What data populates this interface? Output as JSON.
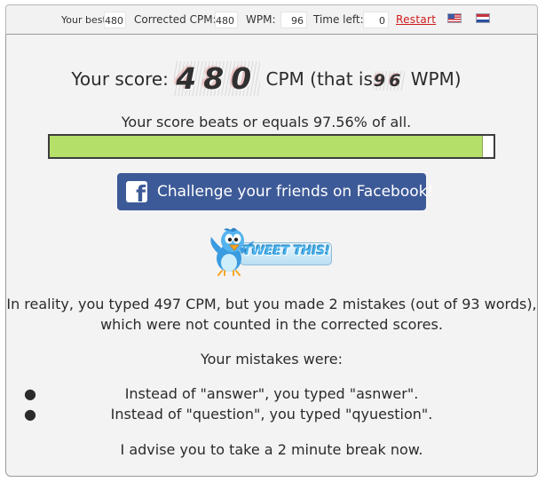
{
  "stats": {
    "your_best_label": "Your best:",
    "your_best_value": "480",
    "corrected_cpm_label": "Corrected CPM:",
    "corrected_cpm_value": "480",
    "wpm_label": "WPM:",
    "wpm_value": "96",
    "time_left_label": "Time left:",
    "time_left_value": "0",
    "restart_label": "Restart",
    "flags": [
      "us-flag-icon",
      "netherlands-flag-icon"
    ]
  },
  "score": {
    "prefix": "Your score:",
    "cpm": "480",
    "middle": "CPM (that is",
    "wpm": "96",
    "suffix": "WPM)"
  },
  "percentile": {
    "text": "Your score beats or equals 97.56% of all.",
    "fill_percent": 97.56,
    "bar_color": "#b4e06a"
  },
  "facebook": {
    "label": "Challenge your friends on Facebook!",
    "icon": "facebook-icon",
    "color": "#3d5a98"
  },
  "tweet": {
    "label": "TWEET THIS!",
    "icon": "twitter-bird-icon"
  },
  "reality": {
    "line1": "In reality, you typed 497 CPM, but you made 2 mistakes (out of 93 words),",
    "line2": "which were not counted in the corrected scores."
  },
  "mistakes": {
    "title": "Your mistakes were:",
    "items": [
      "Instead of \"answer\", you typed \"asnwer\".",
      "Instead of \"question\", you typed \"qyuestion\"."
    ]
  },
  "advice": "I advise you to take a 2 minute break now."
}
